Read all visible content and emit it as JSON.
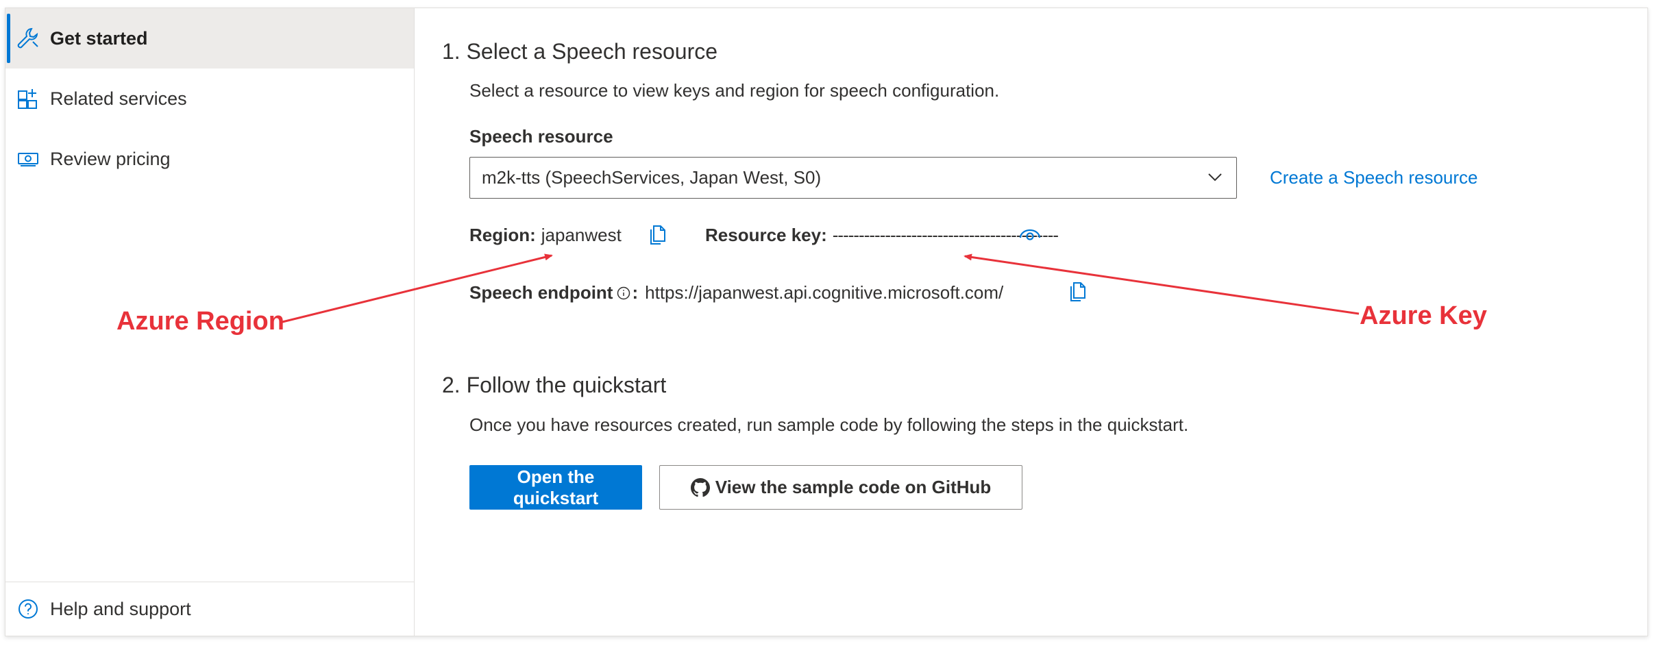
{
  "sidebar": {
    "items": [
      {
        "label": "Get started",
        "icon": "wrench-icon"
      },
      {
        "label": "Related services",
        "icon": "grid-plus-icon"
      },
      {
        "label": "Review pricing",
        "icon": "money-icon"
      }
    ],
    "help": {
      "label": "Help and support",
      "icon": "question-icon"
    }
  },
  "section1": {
    "title": "1. Select a Speech resource",
    "description": "Select a resource to view keys and region for speech configuration.",
    "resource_label": "Speech resource",
    "resource_value": "m2k-tts (SpeechServices, Japan West, S0)",
    "create_link": "Create a Speech resource",
    "region_label": "Region:",
    "region_value": "japanwest",
    "key_label": "Resource key:",
    "key_value": "-------------------------------------------",
    "endpoint_label": "Speech endpoint",
    "endpoint_colon": ":",
    "endpoint_value": "https://japanwest.api.cognitive.microsoft.com/"
  },
  "section2": {
    "title": "2. Follow the quickstart",
    "description": "Once you have resources created, run sample code by following the steps in the quickstart.",
    "primary_button": "Open the quickstart",
    "secondary_button": "View the sample code on GitHub"
  },
  "annotations": {
    "region": "Azure Region",
    "key": "Azure Key",
    "color": "#e8323a"
  },
  "colors": {
    "accent": "#0078d4",
    "active_bg": "#edebe9",
    "text": "#323130"
  }
}
